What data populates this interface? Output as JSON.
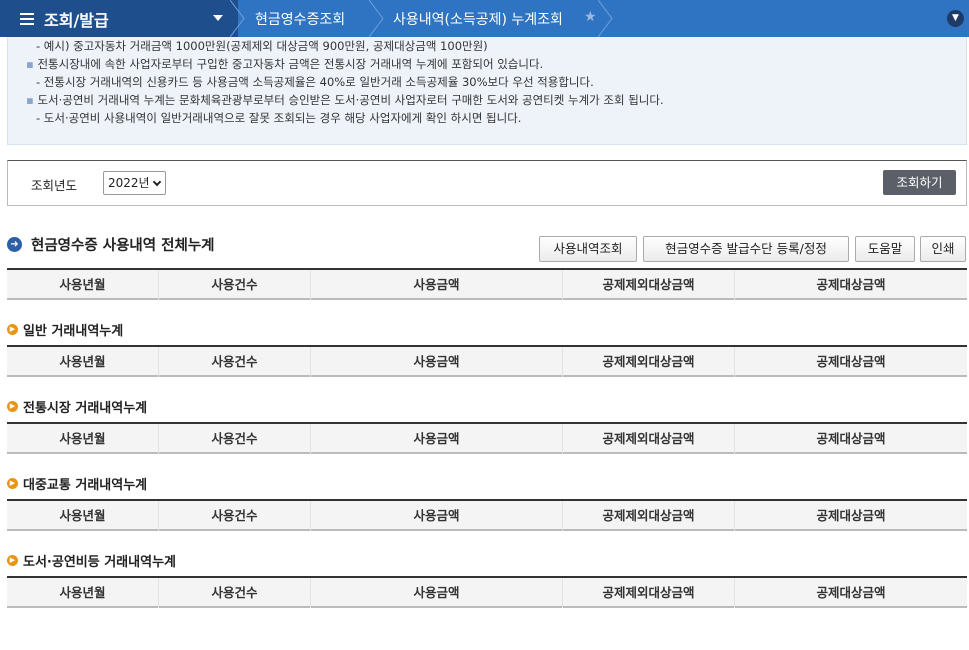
{
  "topbar": {
    "menu_title": "조회/발급",
    "breadcrumbs": [
      "현금영수증조회",
      "사용내역(소득공제) 누계조회"
    ]
  },
  "info": {
    "lines": [
      "- 예시) 중고자동차 거래금액 1000만원(공제제외 대상금액 900만원, 공제대상금액 100만원)",
      "전통시장내에 속한 사업자로부터 구입한 중고자동차 금액은 전통시장 거래내역 누계에 포함되어 있습니다.",
      "- 전통시장 거래내역의 신용카드 등 사용금액 소득공제율은 40%로 일반거래 소득공제율 30%보다 우선 적용합니다.",
      "도서·공연비 거래내역 누계는 문화체육관광부로부터 승인받은 도서·공연비 사업자로터 구매한 도서와 공연티켓 누계가 조회 됩니다.",
      "- 도서·공연비 사용내역이 일반거래내역으로 잘못 조회되는 경우 해당 사업자에게 확인 하시면 됩니다."
    ]
  },
  "search": {
    "label": "조회년도",
    "year_selected": "2022년",
    "submit_label": "조회하기"
  },
  "section": {
    "title": "현금영수증 사용내역 전체누계",
    "buttons": [
      "사용내역조회",
      "현금영수증 발급수단 등록/정정",
      "도움말",
      "인쇄"
    ]
  },
  "columns": [
    "사용년월",
    "사용건수",
    "사용금액",
    "공제제외대상금액",
    "공제대상금액"
  ],
  "subsections": [
    "일반 거래내역누계",
    "전통시장 거래내역누계",
    "대중교통 거래내역누계",
    "도서·공연비등 거래내역누계"
  ]
}
